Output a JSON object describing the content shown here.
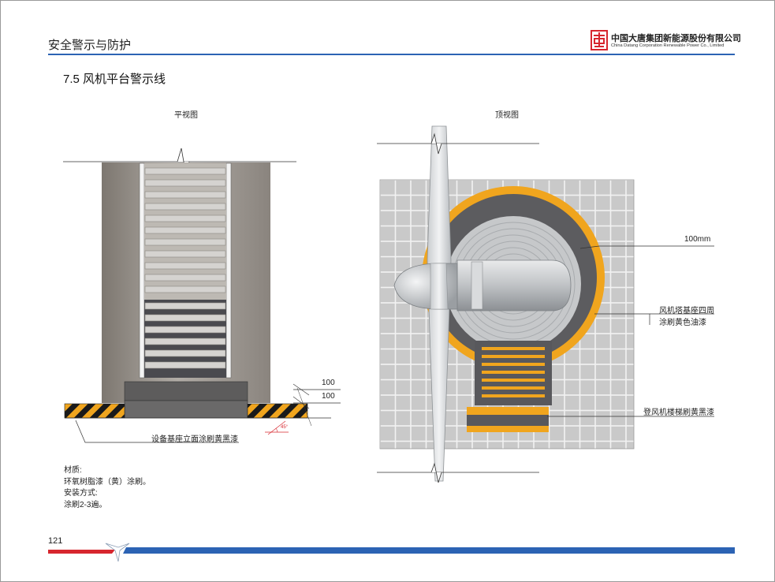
{
  "header": {
    "title": "安全警示与防护",
    "company_cn": "中国大唐集团新能源股份有限公司",
    "company_en": "China Datang Corporation Renewable Power Co., Limited"
  },
  "section": {
    "title": "7.5 风机平台警示线"
  },
  "views": {
    "plan_title": "平视图",
    "top_title": "顶视图"
  },
  "plan_labels": {
    "dim_1": "100",
    "dim_2": "100",
    "angle": "45°",
    "base_note": "设备基座立面涂刷黄黑漆"
  },
  "top_labels": {
    "width": "100mm",
    "tower_note_1": "风机塔基座四周",
    "tower_note_2": "涂刷黄色油漆",
    "ladder_note": "登风机楼梯刷黄黑漆"
  },
  "notes": {
    "material_label": "材质:",
    "material_value": "环氧树脂漆（黄）涂刷。",
    "install_label": "安装方式:",
    "install_value": "涂刷2-3遍。"
  },
  "footer": {
    "page": "121"
  },
  "colors": {
    "accent_blue": "#2c63b4",
    "accent_red": "#d7262e",
    "warning_yellow": "#f0a51e",
    "hazard_black": "#1a1a1a",
    "tile_gray": "#c9c9c9"
  },
  "icons": {
    "logo": "datang-logo-icon"
  }
}
